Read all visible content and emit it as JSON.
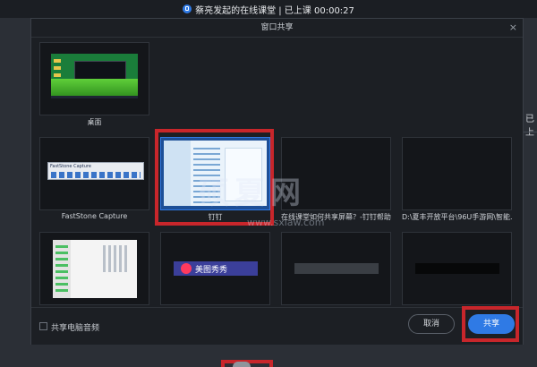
{
  "topbar": {
    "title": "蔡亮发起的在线课堂 | 已上课 00:00:27"
  },
  "side": {
    "right_text": "已上"
  },
  "dialog": {
    "title": "窗口共享",
    "close_glyph": "×",
    "tiles": [
      {
        "label": "桌面",
        "kind": "desktop"
      },
      {
        "label": "FastStone Capture",
        "kind": "faststone",
        "inner_title": "FastStone Capture"
      },
      {
        "label": "钉钉",
        "kind": "dingtalk",
        "selected": true
      },
      {
        "label": "在线课堂如何共享屏幕？-钉钉帮助...",
        "kind": "blank"
      },
      {
        "label": "D:\\夏丰开放平台\\96U手游网\\智能...",
        "kind": "blank"
      },
      {
        "label": "",
        "kind": "wechat"
      },
      {
        "label": "",
        "kind": "meitu",
        "inner_text": "美图秀秀"
      },
      {
        "label": "",
        "kind": "darkbar"
      },
      {
        "label": "",
        "kind": "blackbar"
      }
    ],
    "footer": {
      "checkbox_label": "共享电脑音频",
      "checkbox_checked": false,
      "cancel_label": "取消",
      "share_label": "共享"
    }
  },
  "watermark": {
    "text": "硕夏网",
    "url": "www.sxiaw.com"
  },
  "colors": {
    "accent": "#2f7ae5",
    "highlight": "#c8262b",
    "background": "#23272e"
  }
}
